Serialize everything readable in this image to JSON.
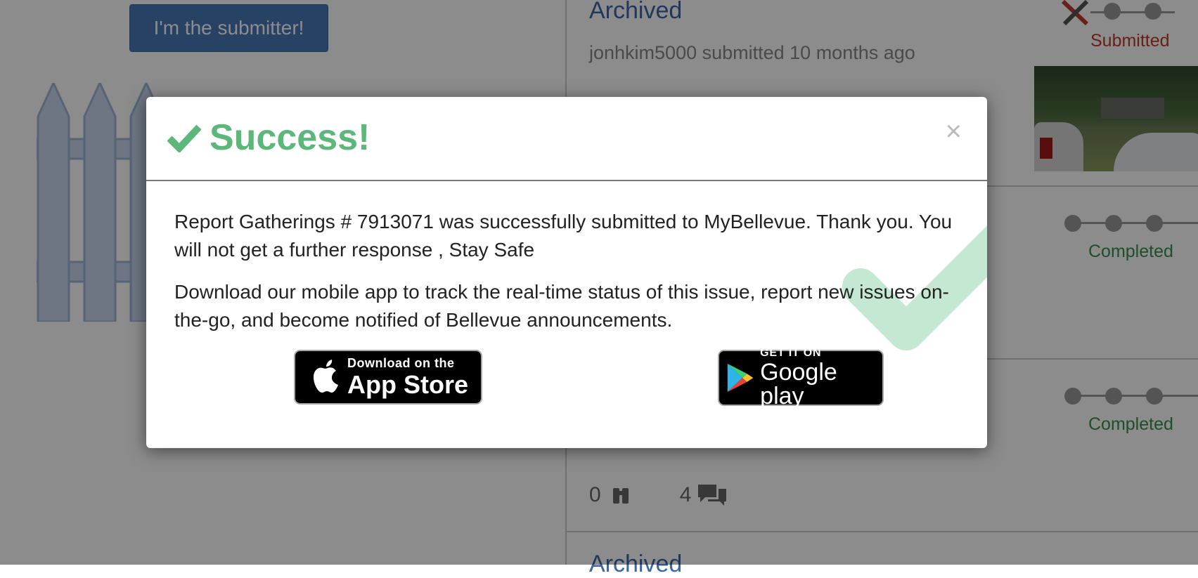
{
  "background": {
    "submitter_button": "I'm the submitter!",
    "cards": [
      {
        "title": "Archived",
        "meta": "jonhkim5000 submitted 10 months ago",
        "status": "Submitted",
        "status_color": "#c0392b"
      },
      {
        "status": "Completed",
        "status_color": "#3a8f4d"
      },
      {
        "status": "Completed",
        "status_color": "#3a8f4d",
        "follower_count": "0",
        "comment_count": "4"
      },
      {
        "title": "Archived"
      }
    ]
  },
  "modal": {
    "title": "Success!",
    "close_label": "×",
    "message": "Report Gatherings # 7913071 was successfully submitted to MyBellevue. Thank you. You will not get a further response , Stay Safe",
    "download_text": "Download our mobile app to track the real-time status of this issue, report new issues on-the-go, and become notified of Bellevue announcements.",
    "app_store": {
      "small": "Download on the",
      "big": "App Store"
    },
    "google_play": {
      "small": "GET IT ON",
      "big": "Google play"
    }
  },
  "colors": {
    "success": "#5cb87a",
    "link": "#3a66a8",
    "primary_button": "#4a78b8"
  }
}
